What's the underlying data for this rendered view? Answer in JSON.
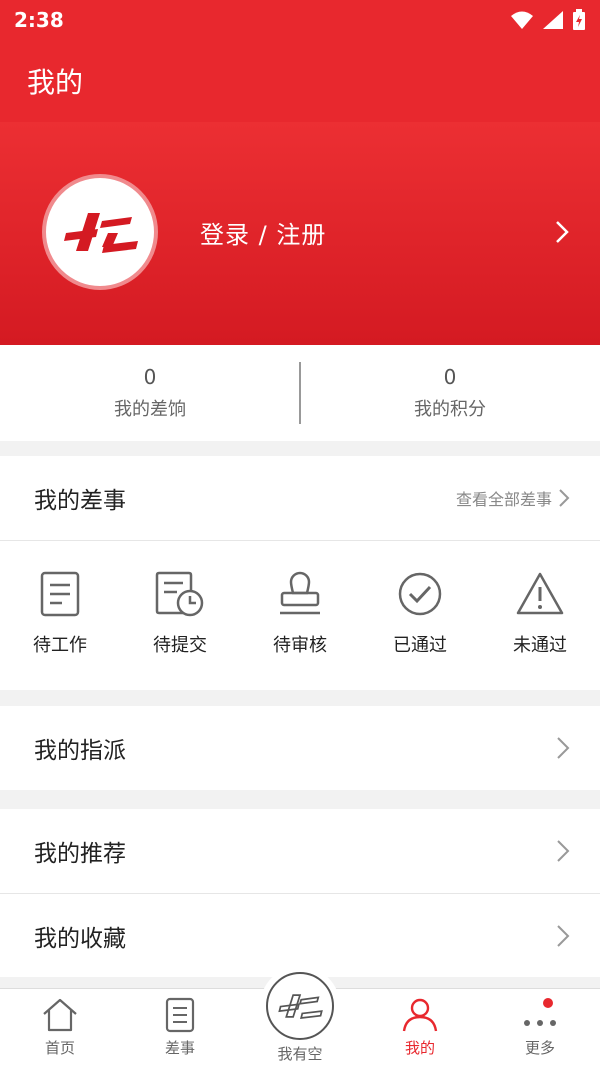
{
  "status_bar": {
    "time": "2:38"
  },
  "app_bar": {
    "title": "我的"
  },
  "profile": {
    "login_text": "登录 / 注册"
  },
  "stats": [
    {
      "value": "0",
      "label": "我的差饷"
    },
    {
      "value": "0",
      "label": "我的积分"
    }
  ],
  "my_tasks": {
    "title": "我的差事",
    "view_all": "查看全部差事",
    "items": [
      {
        "label": "待工作",
        "icon": "document-icon"
      },
      {
        "label": "待提交",
        "icon": "document-clock-icon"
      },
      {
        "label": "待审核",
        "icon": "stamp-icon"
      },
      {
        "label": "已通过",
        "icon": "check-circle-icon"
      },
      {
        "label": "未通过",
        "icon": "warning-icon"
      }
    ]
  },
  "menu": {
    "assign": "我的指派",
    "recommend": "我的推荐",
    "favorites": "我的收藏"
  },
  "tabbar": {
    "home": "首页",
    "tasks": "差事",
    "free": "我有空",
    "mine": "我的",
    "more": "更多"
  },
  "colors": {
    "brand": "#e8282e"
  }
}
